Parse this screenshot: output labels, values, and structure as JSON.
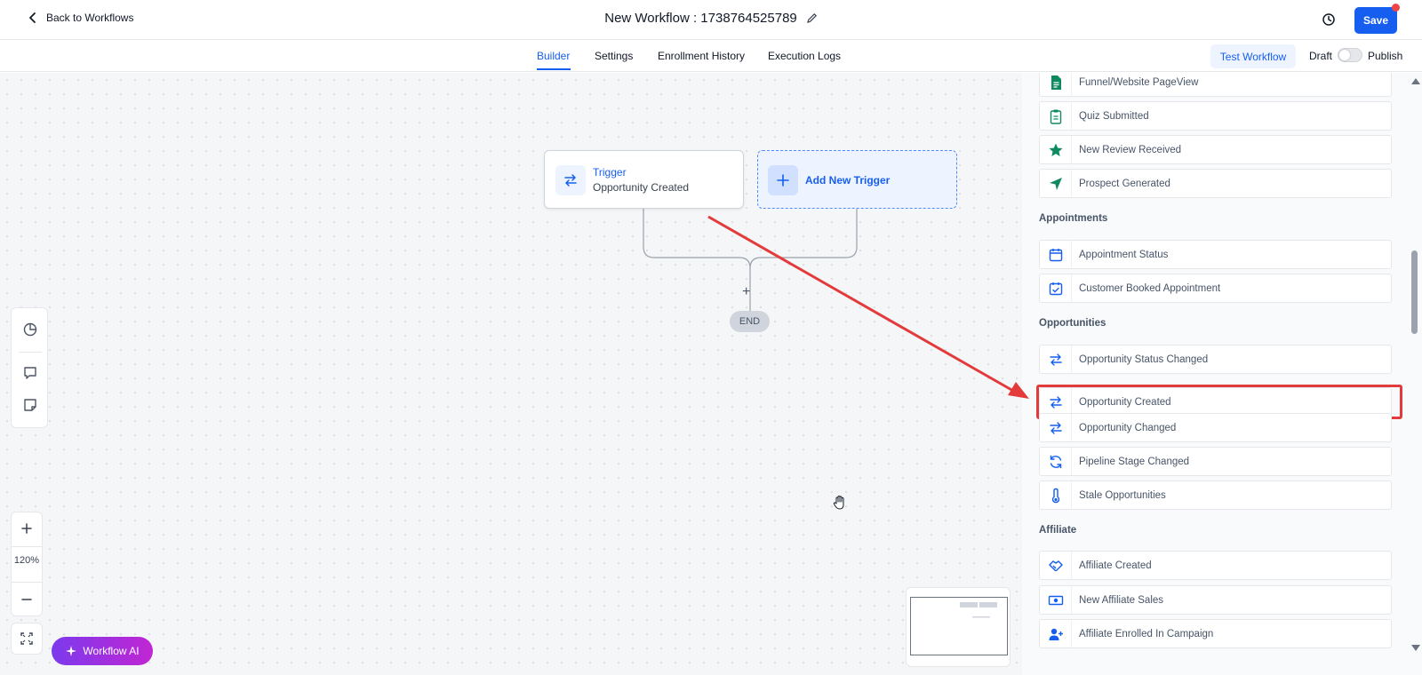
{
  "header": {
    "back_label": "Back to Workflows",
    "title": "New Workflow : 1738764525789",
    "save_label": "Save"
  },
  "tabs": [
    {
      "label": "Builder",
      "active": true
    },
    {
      "label": "Settings",
      "active": false
    },
    {
      "label": "Enrollment History",
      "active": false
    },
    {
      "label": "Execution Logs",
      "active": false
    }
  ],
  "toolbar": {
    "test_label": "Test Workflow",
    "draft_label": "Draft",
    "publish_label": "Publish",
    "publish_enabled": false
  },
  "canvas": {
    "trigger_title": "Trigger",
    "trigger_subtitle": "Opportunity Created",
    "add_trigger_label": "Add New Trigger",
    "end_label": "END",
    "zoom_level": "120%",
    "ai_label": "Workflow AI"
  },
  "panel": {
    "top_items": [
      {
        "label": "Funnel/Website PageView",
        "icon": "document-icon"
      },
      {
        "label": "Quiz Submitted",
        "icon": "clipboard-icon"
      },
      {
        "label": "New Review Received",
        "icon": "star-icon"
      },
      {
        "label": "Prospect Generated",
        "icon": "navigation-icon"
      }
    ],
    "appointments_title": "Appointments",
    "appointments": [
      {
        "label": "Appointment Status",
        "icon": "calendar-icon"
      },
      {
        "label": "Customer Booked Appointment",
        "icon": "calendar-check-icon"
      }
    ],
    "opportunities_title": "Opportunities",
    "opportunities": [
      {
        "label": "Opportunity Status Changed",
        "icon": "swap-icon"
      },
      {
        "label": "Opportunity Created",
        "icon": "swap-icon",
        "highlighted": true
      },
      {
        "label": "Opportunity Changed",
        "icon": "swap-icon"
      },
      {
        "label": "Pipeline Stage Changed",
        "icon": "refresh-icon"
      },
      {
        "label": "Stale Opportunities",
        "icon": "thermometer-icon"
      }
    ],
    "affiliate_title": "Affiliate",
    "affiliate": [
      {
        "label": "Affiliate Created",
        "icon": "handshake-icon"
      },
      {
        "label": "New Affiliate Sales",
        "icon": "money-icon"
      },
      {
        "label": "Affiliate Enrolled In Campaign",
        "icon": "user-plus-icon"
      }
    ]
  },
  "colors": {
    "primary": "#155eef",
    "highlight": "#e33b3b",
    "icon_green": "#0f8a5f",
    "ai_gradient_start": "#7c3aed",
    "ai_gradient_end": "#c026d3"
  }
}
